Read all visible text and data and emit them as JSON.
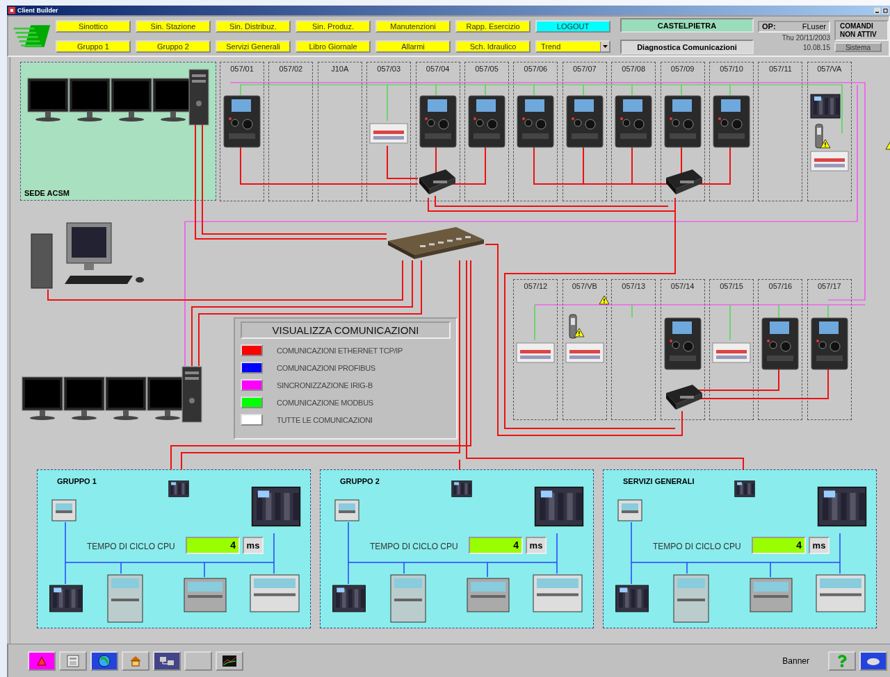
{
  "window": {
    "title": "Client Builder"
  },
  "nav": {
    "rows": [
      [
        {
          "label": "Sinottico",
          "kind": "nav"
        },
        {
          "label": "Sin. Stazione",
          "kind": "nav"
        },
        {
          "label": "Sin. Distribuz.",
          "kind": "nav"
        },
        {
          "label": "Sin. Produz.",
          "kind": "nav"
        },
        {
          "label": "Manutenzioni",
          "kind": "nav"
        },
        {
          "label": "Rapp. Esercizio",
          "kind": "nav"
        },
        {
          "label": "LOGOUT",
          "kind": "logout"
        }
      ],
      [
        {
          "label": "Gruppo 1",
          "kind": "nav"
        },
        {
          "label": "Gruppo 2",
          "kind": "nav"
        },
        {
          "label": "Servizi Generali",
          "kind": "nav"
        },
        {
          "label": "Libro Giornale",
          "kind": "nav"
        },
        {
          "label": "Allarmi",
          "kind": "nav"
        },
        {
          "label": "Sch. Idraulico",
          "kind": "nav"
        },
        {
          "label": "Trend",
          "kind": "dropdown"
        }
      ]
    ]
  },
  "station": {
    "name": "CASTELPIETRA",
    "page": "Diagnostica Comunicazioni"
  },
  "operator": {
    "label": "OP:",
    "value": "FLuser",
    "date": "Thu 20/11/2003",
    "time": "10.08.15"
  },
  "commands": {
    "lines": [
      "COMANDI",
      "NON ATTIV"
    ],
    "button": "Sistema"
  },
  "diagram": {
    "site": "SEDE ACSM",
    "top_bays": [
      {
        "label": "057/01",
        "kind": "relay"
      },
      {
        "label": "057/02",
        "kind": "empty"
      },
      {
        "label": "J10A",
        "kind": "empty"
      },
      {
        "label": "057/03",
        "kind": "module"
      },
      {
        "label": "057/04",
        "kind": "relay"
      },
      {
        "label": "057/05",
        "kind": "relay"
      },
      {
        "label": "057/06",
        "kind": "relay"
      },
      {
        "label": "057/07",
        "kind": "relay"
      },
      {
        "label": "057/08",
        "kind": "relay"
      },
      {
        "label": "057/09",
        "kind": "relay"
      },
      {
        "label": "057/10",
        "kind": "relay"
      },
      {
        "label": "057/11",
        "kind": "empty"
      },
      {
        "label": "057/VA",
        "kind": "plc"
      }
    ],
    "bottom_bays": [
      {
        "label": "057/12",
        "kind": "module"
      },
      {
        "label": "057/VB",
        "kind": "sensor"
      },
      {
        "label": "057/13",
        "kind": "empty"
      },
      {
        "label": "057/14",
        "kind": "relay"
      },
      {
        "label": "057/15",
        "kind": "module"
      },
      {
        "label": "057/16",
        "kind": "relay"
      },
      {
        "label": "057/17",
        "kind": "relay"
      }
    ],
    "legend": {
      "title": "VISUALIZZA COMUNICAZIONI",
      "items": [
        {
          "label": "COMUNICAZIONI ETHERNET TCP/IP",
          "color": "#ff0000"
        },
        {
          "label": "COMUNICAZIONI PROFIBUS",
          "color": "#0000ff"
        },
        {
          "label": "SINCRONIZZAZIONE IRIG-B",
          "color": "#ff00ff"
        },
        {
          "label": "COMUNICAZIONE MODBUS",
          "color": "#00ff00"
        },
        {
          "label": "TUTTE LE COMUNICAZIONI",
          "color": "#ffffff"
        }
      ]
    },
    "groups": [
      {
        "title": "GRUPPO 1",
        "cycle_label": "TEMPO DI CICLO CPU",
        "value": "4",
        "unit": "ms"
      },
      {
        "title": "GRUPPO 2",
        "cycle_label": "TEMPO DI CICLO CPU",
        "value": "4",
        "unit": "ms"
      },
      {
        "title": "SERVIZI GENERALI",
        "cycle_label": "TEMPO DI CICLO CPU",
        "value": "4",
        "unit": "ms"
      }
    ]
  },
  "footer": {
    "banner": "Banner"
  }
}
